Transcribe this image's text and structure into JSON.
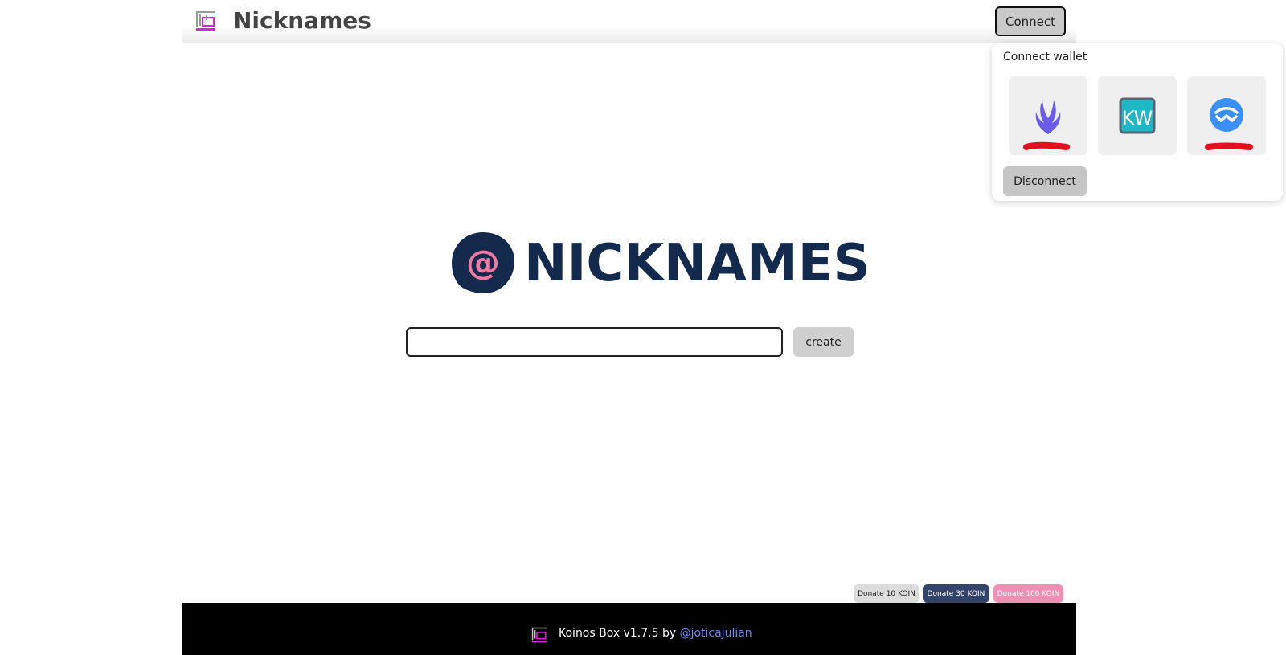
{
  "header": {
    "title": "Nicknames",
    "logo_icon": "koinos-box-logo-icon",
    "connect_label": "Connect"
  },
  "wallet_menu": {
    "title": "Connect wallet",
    "options": [
      {
        "icon": "kondor-wings-icon"
      },
      {
        "icon": "koinos-wallet-kw-icon"
      },
      {
        "icon": "walletconnect-icon"
      }
    ],
    "disconnect_label": "Disconnect"
  },
  "hero": {
    "wordmark": "NICKNAMES",
    "logo_icon": "at-sign-logo-icon",
    "logo_glyph": "@"
  },
  "form": {
    "input_value": "",
    "create_label": "create"
  },
  "donate": {
    "btn_10": "Donate 10 KOIN",
    "btn_30": "Donate 30 KOIN",
    "btn_100": "Donate 100 KOIN"
  },
  "footer": {
    "text": "Koinos Box v1.7.5 by ",
    "author": "@joticajulian"
  },
  "colors": {
    "brand_navy": "#142a4d",
    "brand_pink": "#f07aa3",
    "link_blue": "#6c84ff",
    "donate_30_bg": "#334468",
    "donate_100_bg": "#f08fb4"
  }
}
